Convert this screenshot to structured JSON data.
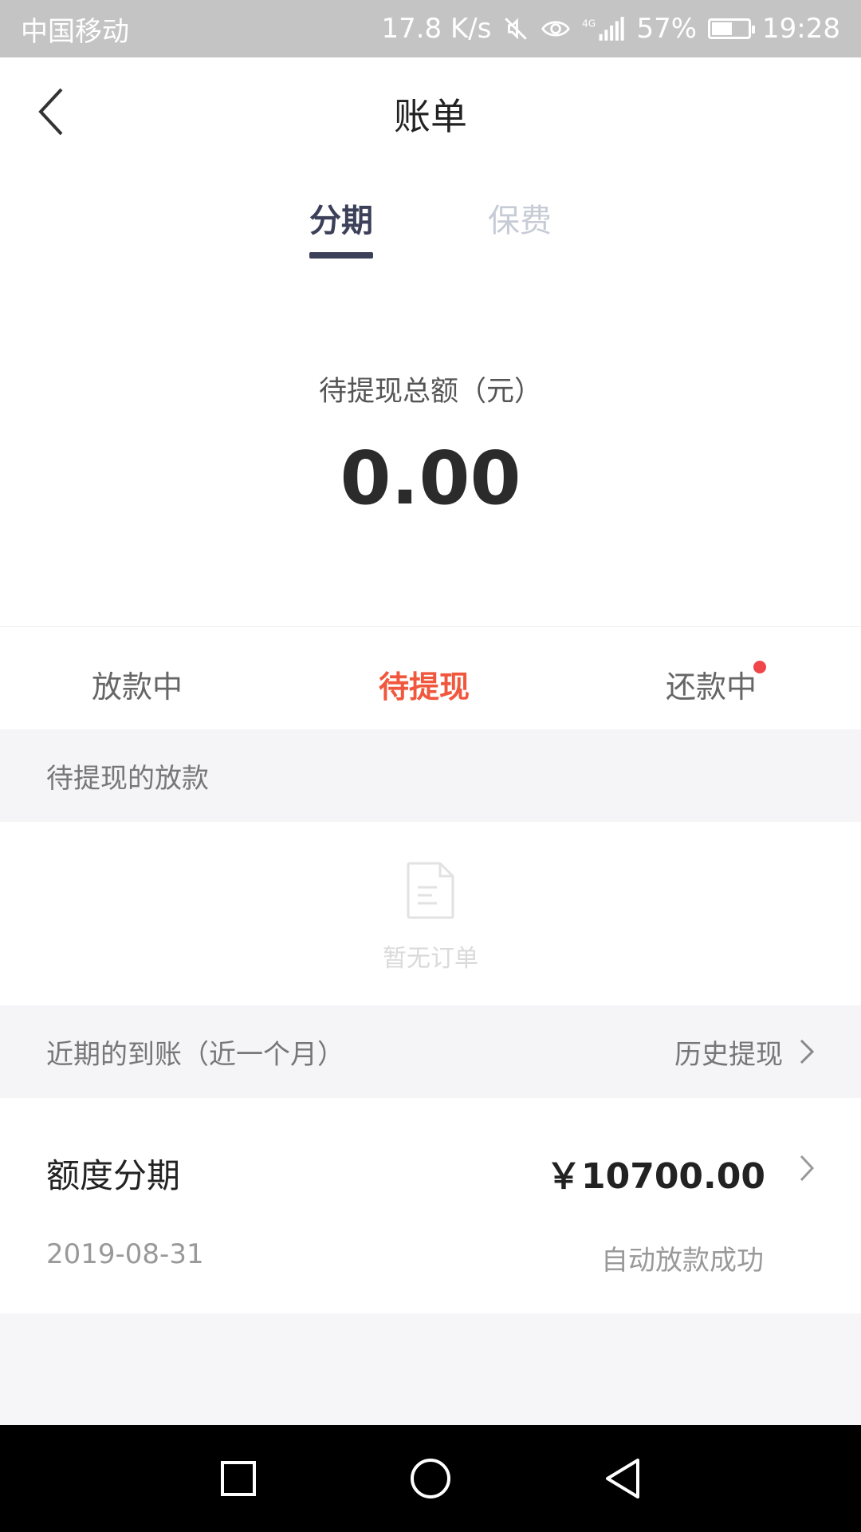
{
  "status_bar": {
    "carrier": "中国移动",
    "net_speed": "17.8 K/s",
    "network": "4G",
    "battery_percent": "57%",
    "battery_level": 0.57,
    "time": "19:28"
  },
  "header": {
    "title": "账单"
  },
  "top_tabs": {
    "active": "分期",
    "inactive": "保费"
  },
  "summary": {
    "label": "待提现总额（元）",
    "amount": "0.00"
  },
  "sub_tabs": {
    "items": [
      "放款中",
      "待提现",
      "还款中"
    ],
    "active_index": 1,
    "badge_on": "还款中"
  },
  "pending_section": {
    "title": "待提现的放款",
    "empty_text": "暂无订单"
  },
  "recent_section": {
    "title": "近期的到账（近一个月）",
    "history_link": "历史提现"
  },
  "record": {
    "title": "额度分期",
    "amount": "￥10700.00",
    "date": "2019-08-31",
    "status": "自动放款成功"
  },
  "colors": {
    "accent_red": "#f0573d",
    "tab_dark": "#3c4058",
    "tab_inactive": "#c7cbd6",
    "badge_red": "#f0464a"
  },
  "icons": [
    "back-arrow-icon",
    "mute-icon",
    "eye-icon",
    "signal-icon",
    "battery-icon",
    "document-icon",
    "chevron-right-icon",
    "square-nav-icon",
    "circle-nav-icon",
    "triangle-nav-icon"
  ]
}
